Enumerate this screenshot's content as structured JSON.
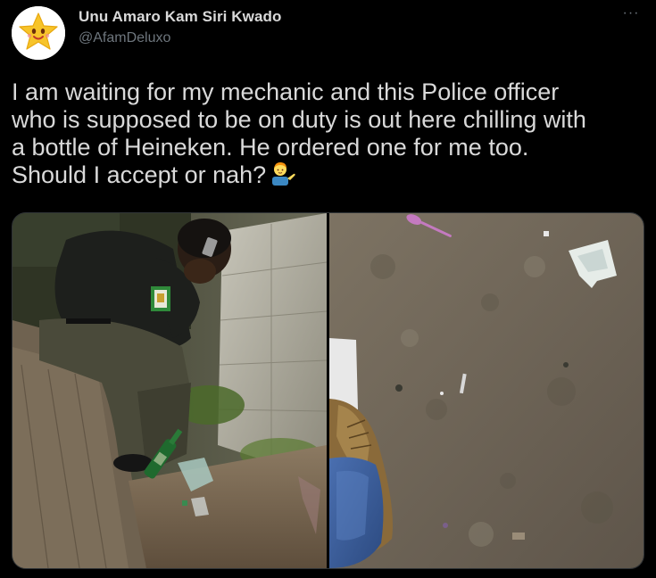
{
  "tweet": {
    "author": {
      "display_name": "Unu Amaro Kam Siri Kwado",
      "handle": "@AfamDeluxo",
      "avatar_icon": "star-face-emoji-icon"
    },
    "more_icon": "more-options-icon",
    "more_glyph": "···",
    "text_lines": [
      "I am waiting for my mechanic and this Police officer",
      "who is supposed to be on duty is out here chilling with",
      "a bottle of Heineken. He ordered one for me too.",
      "Should I accept or nah?"
    ],
    "trailing_emoji": "person-tipping-hand-emoji-icon",
    "media": {
      "count": 2,
      "photos": [
        {
          "subject": "officer-sitting-on-phone-photo"
        },
        {
          "subject": "dirt-ground-and-boot-photo"
        }
      ]
    },
    "colors": {
      "background": "#000000",
      "text_primary": "#d9d9d9",
      "text_secondary": "#6e767d",
      "border": "#2f3336"
    }
  }
}
